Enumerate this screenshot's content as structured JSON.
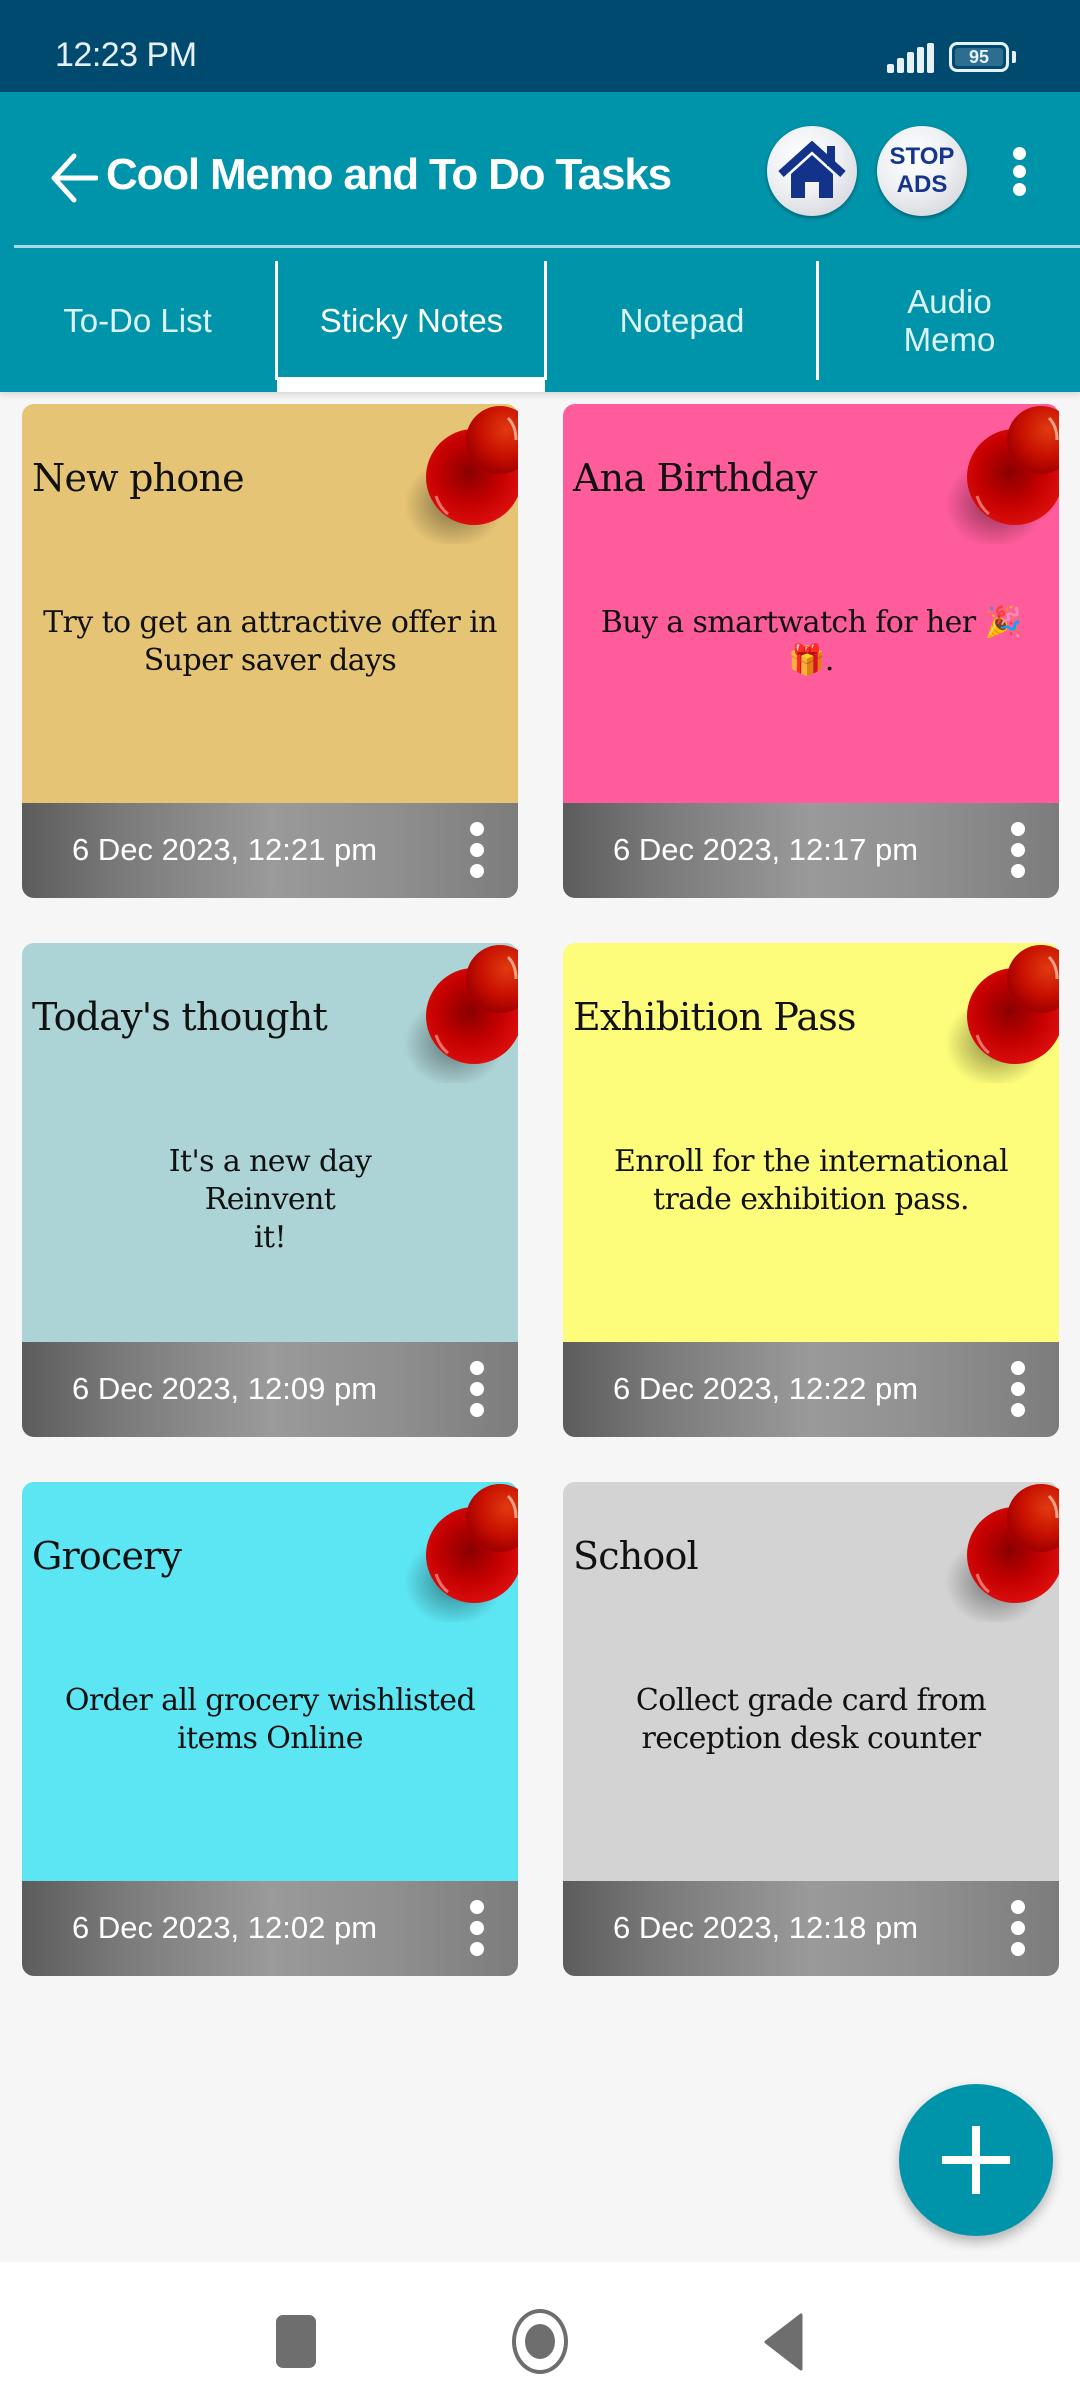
{
  "status_bar": {
    "time": "12:23 PM",
    "battery_level": "95",
    "signal_bars": 4
  },
  "app_bar": {
    "back_icon": "arrow-left-icon",
    "title": "Cool Memo and To Do Tasks",
    "home_button_icon": "home-icon",
    "stop_ads_line1": "STOP",
    "stop_ads_line2": "ADS",
    "overflow_icon": "more-vertical-icon"
  },
  "tabs": [
    {
      "label": "To-Do List",
      "active": false
    },
    {
      "label": "Sticky Notes",
      "active": true
    },
    {
      "label": "Notepad",
      "active": false
    },
    {
      "label": "Audio\nMemo",
      "active": false
    }
  ],
  "notes": [
    {
      "title": "New phone",
      "text": "Try to get an attractive offer in Super saver days",
      "date": "6 Dec 2023, 12:21 pm",
      "color": "#e5c475"
    },
    {
      "title": "Ana Birthday",
      "text": "Buy a smartwatch for her 🎉 🎁.",
      "date": "6 Dec 2023, 12:17 pm",
      "color": "#ff5c9b"
    },
    {
      "title": "Today's thought",
      "text": "It's a new day\n    Reinvent\n       it!",
      "date": "6 Dec 2023, 12:09 pm",
      "color": "#acd3d5"
    },
    {
      "title": "Exhibition Pass",
      "text": "Enroll for the international trade exhibition pass.",
      "date": "6 Dec 2023, 12:22 pm",
      "color": "#fdfd7b"
    },
    {
      "title": "Grocery",
      "text": "Order all grocery wishlisted items Online",
      "date": "6 Dec 2023, 12:02 pm",
      "color": "#5ce6f4"
    },
    {
      "title": "School",
      "text": "Collect grade card  from reception desk counter",
      "date": "6 Dec 2023, 12:18 pm",
      "color": "#d3d3d3"
    }
  ],
  "fab": {
    "icon": "plus-icon",
    "color": "#0094aa"
  },
  "nav_bar": {
    "recents_icon": "square-icon",
    "home_icon": "circle-icon",
    "back_icon": "triangle-back-icon"
  },
  "colors": {
    "status_bar": "#004a70",
    "accent": "#0094aa",
    "pin": "#cc0000"
  }
}
